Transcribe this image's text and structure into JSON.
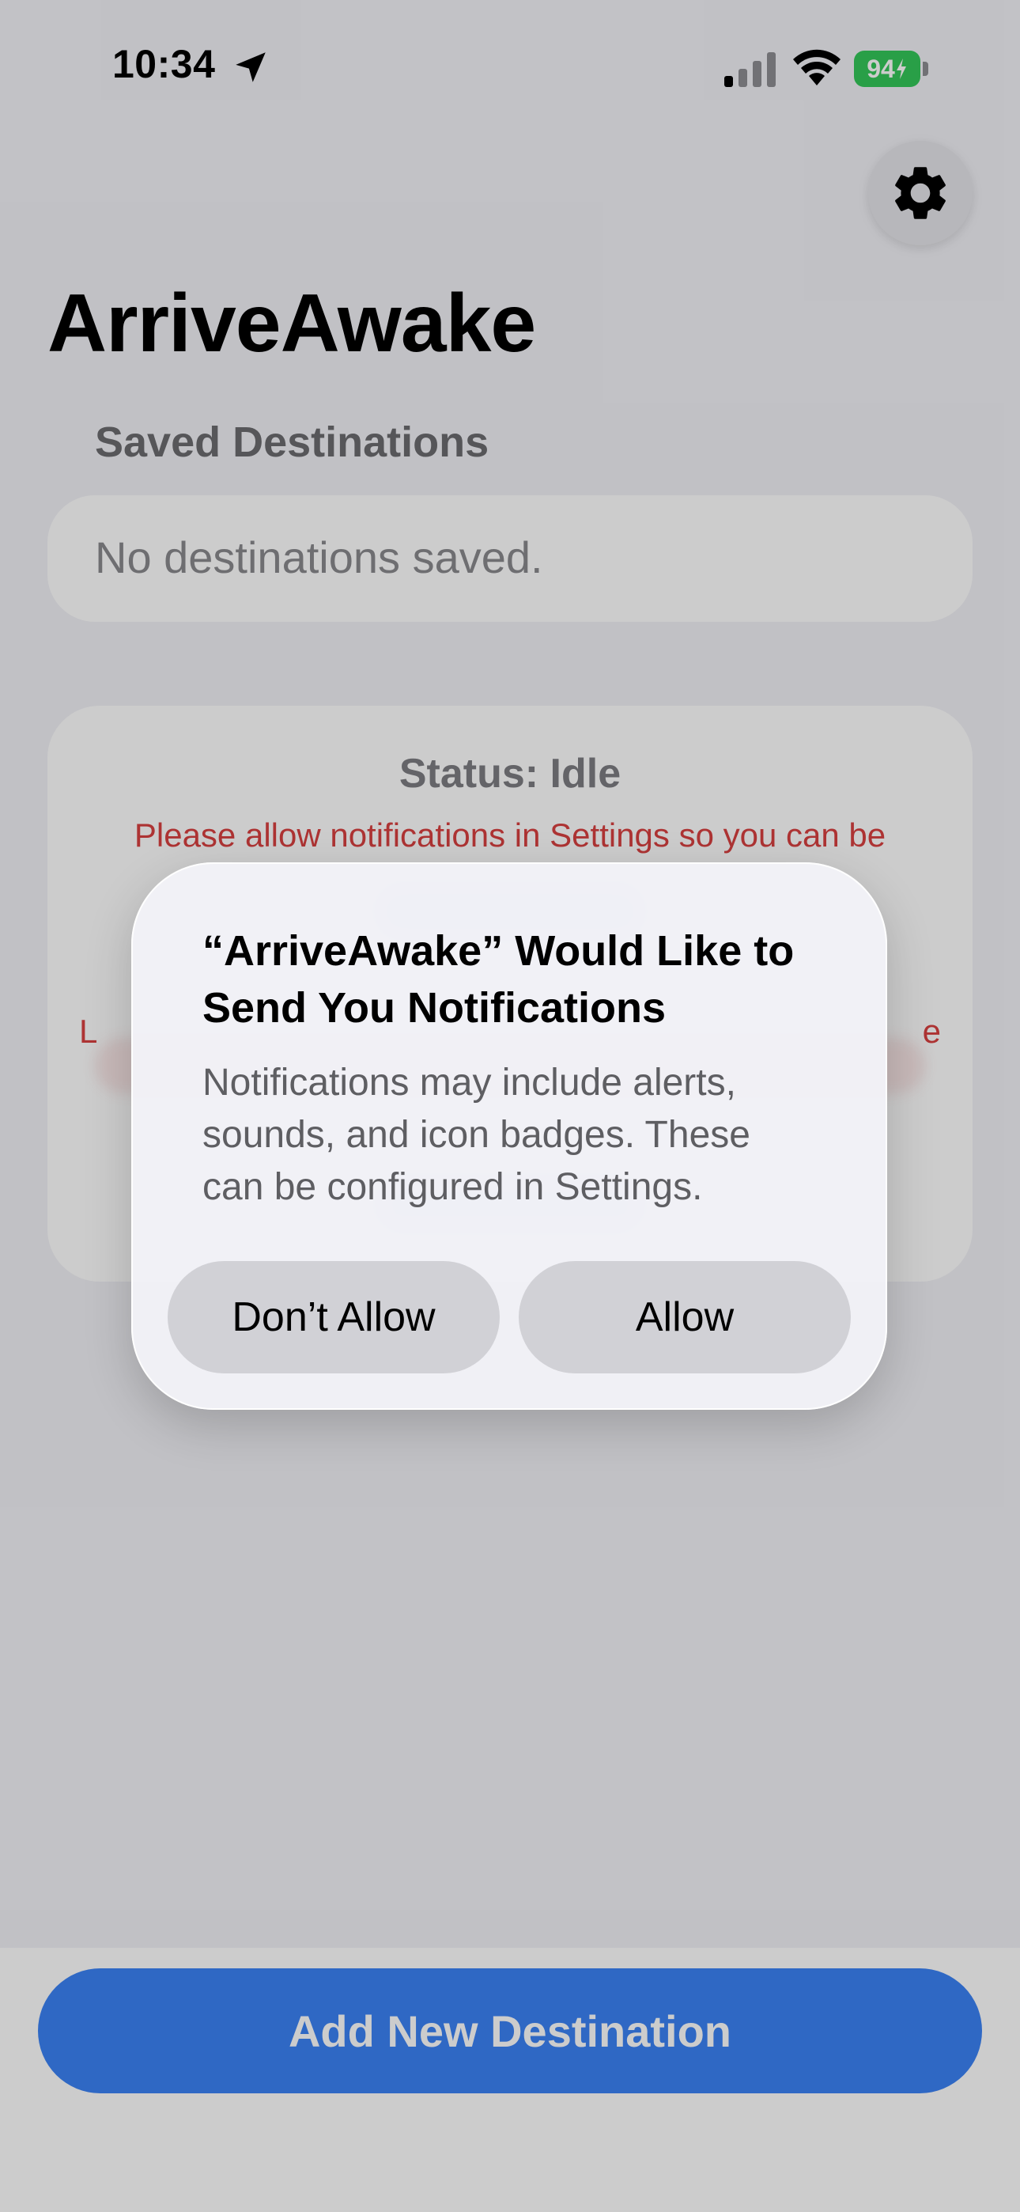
{
  "status_bar": {
    "time": "10:34",
    "battery": "94"
  },
  "app": {
    "title": "ArriveAwake"
  },
  "saved": {
    "header": "Saved Destinations",
    "empty_text": "No destinations saved."
  },
  "status_card": {
    "status": "Status: Idle",
    "notification_warning": "Please allow notifications in Settings so you can be",
    "location_warning_start": "L",
    "location_warning_end": "e"
  },
  "bottom": {
    "add_button": "Add New Destination"
  },
  "alert": {
    "title": "“ArriveAwake” Would Like to Send You Notifications",
    "message": "Notifications may include alerts, sounds, and icon badges. These can be configured in Settings.",
    "deny_label": "Don’t Allow",
    "allow_label": "Allow"
  },
  "colors": {
    "accent": "#3b82f6",
    "warning": "#d94040",
    "battery": "#34c759"
  },
  "icons": [
    "location-arrow-icon",
    "cellular-signal-icon",
    "wifi-icon",
    "battery-icon",
    "gear-icon"
  ]
}
